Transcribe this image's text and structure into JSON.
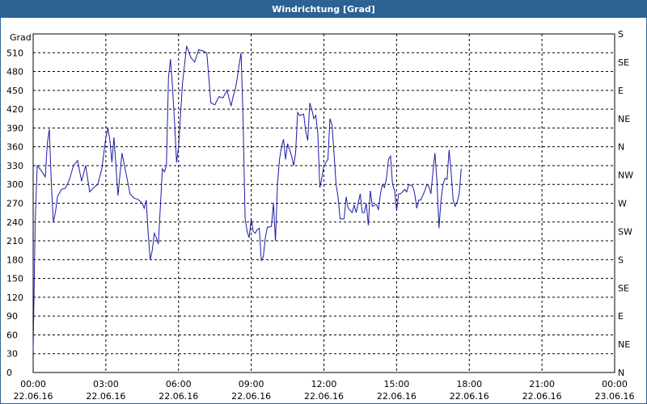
{
  "window": {
    "title": "Windrichtung [Grad]"
  },
  "colors": {
    "line": "#1a1aa8",
    "titlebar": "#2a6293",
    "grid": "#000000"
  },
  "chart_data": {
    "type": "line",
    "title": "Windrichtung [Grad]",
    "ylabel": "Grad",
    "ylim": [
      0,
      540
    ],
    "xlim": [
      "22.06.16 00:00",
      "23.06.16 00:00"
    ],
    "grid": true,
    "y_ticks": [
      0,
      30,
      60,
      90,
      120,
      150,
      180,
      210,
      240,
      270,
      300,
      330,
      360,
      390,
      420,
      450,
      480,
      510
    ],
    "right_ticks": [
      "N",
      "NE",
      "E",
      "SE",
      "S",
      "SW",
      "W",
      "NW",
      "N",
      "NE",
      "E",
      "SE",
      "S"
    ],
    "x_ticks": [
      {
        "time": "00:00",
        "date": "22.06.16"
      },
      {
        "time": "03:00",
        "date": "22.06.16"
      },
      {
        "time": "06:00",
        "date": "22.06.16"
      },
      {
        "time": "09:00",
        "date": "22.06.16"
      },
      {
        "time": "12:00",
        "date": "22.06.16"
      },
      {
        "time": "15:00",
        "date": "22.06.16"
      },
      {
        "time": "18:00",
        "date": "22.06.16"
      },
      {
        "time": "21:00",
        "date": "22.06.16"
      },
      {
        "time": "00:00",
        "date": "23.06.16"
      }
    ],
    "series": [
      {
        "values": [
          [
            "22.06.16 00:00",
            35
          ],
          [
            "22.06.16 00:05",
            240
          ],
          [
            "22.06.16 00:10",
            330
          ],
          [
            "22.06.16 00:20",
            322
          ],
          [
            "22.06.16 00:30",
            312
          ],
          [
            "22.06.16 00:35",
            365
          ],
          [
            "22.06.16 00:40",
            388
          ],
          [
            "22.06.16 00:45",
            300
          ],
          [
            "22.06.16 00:50",
            240
          ],
          [
            "22.06.16 00:55",
            255
          ],
          [
            "22.06.16 01:00",
            280
          ],
          [
            "22.06.16 01:10",
            292
          ],
          [
            "22.06.16 01:20",
            294
          ],
          [
            "22.06.16 01:30",
            308
          ],
          [
            "22.06.16 01:40",
            330
          ],
          [
            "22.06.16 01:50",
            338
          ],
          [
            "22.06.16 02:00",
            305
          ],
          [
            "22.06.16 02:10",
            330
          ],
          [
            "22.06.16 02:20",
            288
          ],
          [
            "22.06.16 02:30",
            295
          ],
          [
            "22.06.16 02:40",
            300
          ],
          [
            "22.06.16 02:50",
            325
          ],
          [
            "22.06.16 03:00",
            375
          ],
          [
            "22.06.16 03:05",
            390
          ],
          [
            "22.06.16 03:10",
            370
          ],
          [
            "22.06.16 03:15",
            335
          ],
          [
            "22.06.16 03:20",
            375
          ],
          [
            "22.06.16 03:30",
            282
          ],
          [
            "22.06.16 03:40",
            350
          ],
          [
            "22.06.16 03:50",
            318
          ],
          [
            "22.06.16 04:00",
            285
          ],
          [
            "22.06.16 04:10",
            278
          ],
          [
            "22.06.16 04:20",
            276
          ],
          [
            "22.06.16 04:30",
            270
          ],
          [
            "22.06.16 04:35",
            262
          ],
          [
            "22.06.16 04:40",
            275
          ],
          [
            "22.06.16 04:45",
            220
          ],
          [
            "22.06.16 04:50",
            180
          ],
          [
            "22.06.16 04:55",
            195
          ],
          [
            "22.06.16 05:00",
            222
          ],
          [
            "22.06.16 05:05",
            215
          ],
          [
            "22.06.16 05:10",
            205
          ],
          [
            "22.06.16 05:15",
            265
          ],
          [
            "22.06.16 05:20",
            325
          ],
          [
            "22.06.16 05:25",
            320
          ],
          [
            "22.06.16 05:30",
            330
          ],
          [
            "22.06.16 05:35",
            470
          ],
          [
            "22.06.16 05:40",
            500
          ],
          [
            "22.06.16 05:45",
            455
          ],
          [
            "22.06.16 05:50",
            400
          ],
          [
            "22.06.16 05:55",
            335
          ],
          [
            "22.06.16 06:00",
            360
          ],
          [
            "22.06.16 06:10",
            462
          ],
          [
            "22.06.16 06:20",
            520
          ],
          [
            "22.06.16 06:25",
            513
          ],
          [
            "22.06.16 06:30",
            503
          ],
          [
            "22.06.16 06:40",
            495
          ],
          [
            "22.06.16 06:50",
            515
          ],
          [
            "22.06.16 07:00",
            513
          ],
          [
            "22.06.16 07:10",
            510
          ],
          [
            "22.06.16 07:15",
            470
          ],
          [
            "22.06.16 07:20",
            430
          ],
          [
            "22.06.16 07:30",
            427
          ],
          [
            "22.06.16 07:40",
            440
          ],
          [
            "22.06.16 07:50",
            438
          ],
          [
            "22.06.16 08:00",
            450
          ],
          [
            "22.06.16 08:10",
            425
          ],
          [
            "22.06.16 08:15",
            440
          ],
          [
            "22.06.16 08:20",
            450
          ],
          [
            "22.06.16 08:25",
            467
          ],
          [
            "22.06.16 08:30",
            490
          ],
          [
            "22.06.16 08:35",
            510
          ],
          [
            "22.06.16 08:40",
            400
          ],
          [
            "22.06.16 08:45",
            245
          ],
          [
            "22.06.16 08:50",
            225
          ],
          [
            "22.06.16 08:55",
            215
          ],
          [
            "22.06.16 09:00",
            245
          ],
          [
            "22.06.16 09:05",
            225
          ],
          [
            "22.06.16 09:10",
            222
          ],
          [
            "22.06.16 09:15",
            228
          ],
          [
            "22.06.16 09:20",
            230
          ],
          [
            "22.06.16 09:25",
            178
          ],
          [
            "22.06.16 09:30",
            185
          ],
          [
            "22.06.16 09:35",
            215
          ],
          [
            "22.06.16 09:40",
            232
          ],
          [
            "22.06.16 09:45",
            232
          ],
          [
            "22.06.16 09:50",
            233
          ],
          [
            "22.06.16 09:55",
            270
          ],
          [
            "22.06.16 10:00",
            210
          ],
          [
            "22.06.16 10:05",
            300
          ],
          [
            "22.06.16 10:10",
            340
          ],
          [
            "22.06.16 10:15",
            360
          ],
          [
            "22.06.16 10:20",
            372
          ],
          [
            "22.06.16 10:25",
            340
          ],
          [
            "22.06.16 10:30",
            365
          ],
          [
            "22.06.16 10:40",
            345
          ],
          [
            "22.06.16 10:45",
            330
          ],
          [
            "22.06.16 10:50",
            350
          ],
          [
            "22.06.16 10:55",
            415
          ],
          [
            "22.06.16 11:00",
            410
          ],
          [
            "22.06.16 11:10",
            412
          ],
          [
            "22.06.16 11:15",
            385
          ],
          [
            "22.06.16 11:20",
            370
          ],
          [
            "22.06.16 11:25",
            430
          ],
          [
            "22.06.16 11:30",
            420
          ],
          [
            "22.06.16 11:35",
            405
          ],
          [
            "22.06.16 11:40",
            410
          ],
          [
            "22.06.16 11:45",
            380
          ],
          [
            "22.06.16 11:50",
            295
          ],
          [
            "22.06.16 11:55",
            310
          ],
          [
            "22.06.16 12:00",
            330
          ],
          [
            "22.06.16 12:10",
            340
          ],
          [
            "22.06.16 12:15",
            405
          ],
          [
            "22.06.16 12:20",
            395
          ],
          [
            "22.06.16 12:25",
            350
          ],
          [
            "22.06.16 12:30",
            300
          ],
          [
            "22.06.16 12:35",
            280
          ],
          [
            "22.06.16 12:40",
            245
          ],
          [
            "22.06.16 12:50",
            245
          ],
          [
            "22.06.16 12:55",
            280
          ],
          [
            "22.06.16 13:00",
            262
          ],
          [
            "22.06.16 13:10",
            255
          ],
          [
            "22.06.16 13:15",
            267
          ],
          [
            "22.06.16 13:20",
            255
          ],
          [
            "22.06.16 13:30",
            285
          ],
          [
            "22.06.16 13:35",
            255
          ],
          [
            "22.06.16 13:40",
            255
          ],
          [
            "22.06.16 13:45",
            270
          ],
          [
            "22.06.16 13:50",
            235
          ],
          [
            "22.06.16 13:55",
            290
          ],
          [
            "22.06.16 14:00",
            265
          ],
          [
            "22.06.16 14:10",
            268
          ],
          [
            "22.06.16 14:15",
            260
          ],
          [
            "22.06.16 14:20",
            285
          ],
          [
            "22.06.16 14:25",
            300
          ],
          [
            "22.06.16 14:30",
            295
          ],
          [
            "22.06.16 14:35",
            310
          ],
          [
            "22.06.16 14:40",
            340
          ],
          [
            "22.06.16 14:45",
            345
          ],
          [
            "22.06.16 14:50",
            300
          ],
          [
            "22.06.16 14:55",
            290
          ],
          [
            "22.06.16 15:00",
            258
          ],
          [
            "22.06.16 15:05",
            285
          ],
          [
            "22.06.16 15:10",
            285
          ],
          [
            "22.06.16 15:20",
            292
          ],
          [
            "22.06.16 15:25",
            288
          ],
          [
            "22.06.16 15:30",
            300
          ],
          [
            "22.06.16 15:40",
            297
          ],
          [
            "22.06.16 15:45",
            285
          ],
          [
            "22.06.16 15:50",
            262
          ],
          [
            "22.06.16 15:55",
            275
          ],
          [
            "22.06.16 16:00",
            275
          ],
          [
            "22.06.16 16:10",
            290
          ],
          [
            "22.06.16 16:15",
            300
          ],
          [
            "22.06.16 16:20",
            297
          ],
          [
            "22.06.16 16:25",
            285
          ],
          [
            "22.06.16 16:30",
            320
          ],
          [
            "22.06.16 16:35",
            350
          ],
          [
            "22.06.16 16:40",
            305
          ],
          [
            "22.06.16 16:45",
            230
          ],
          [
            "22.06.16 16:50",
            275
          ],
          [
            "22.06.16 16:55",
            300
          ],
          [
            "22.06.16 17:00",
            310
          ],
          [
            "22.06.16 17:05",
            308
          ],
          [
            "22.06.16 17:10",
            355
          ],
          [
            "22.06.16 17:15",
            320
          ],
          [
            "22.06.16 17:20",
            275
          ],
          [
            "22.06.16 17:25",
            265
          ],
          [
            "22.06.16 17:30",
            272
          ],
          [
            "22.06.16 17:35",
            285
          ],
          [
            "22.06.16 17:40",
            325
          ]
        ]
      }
    ]
  }
}
